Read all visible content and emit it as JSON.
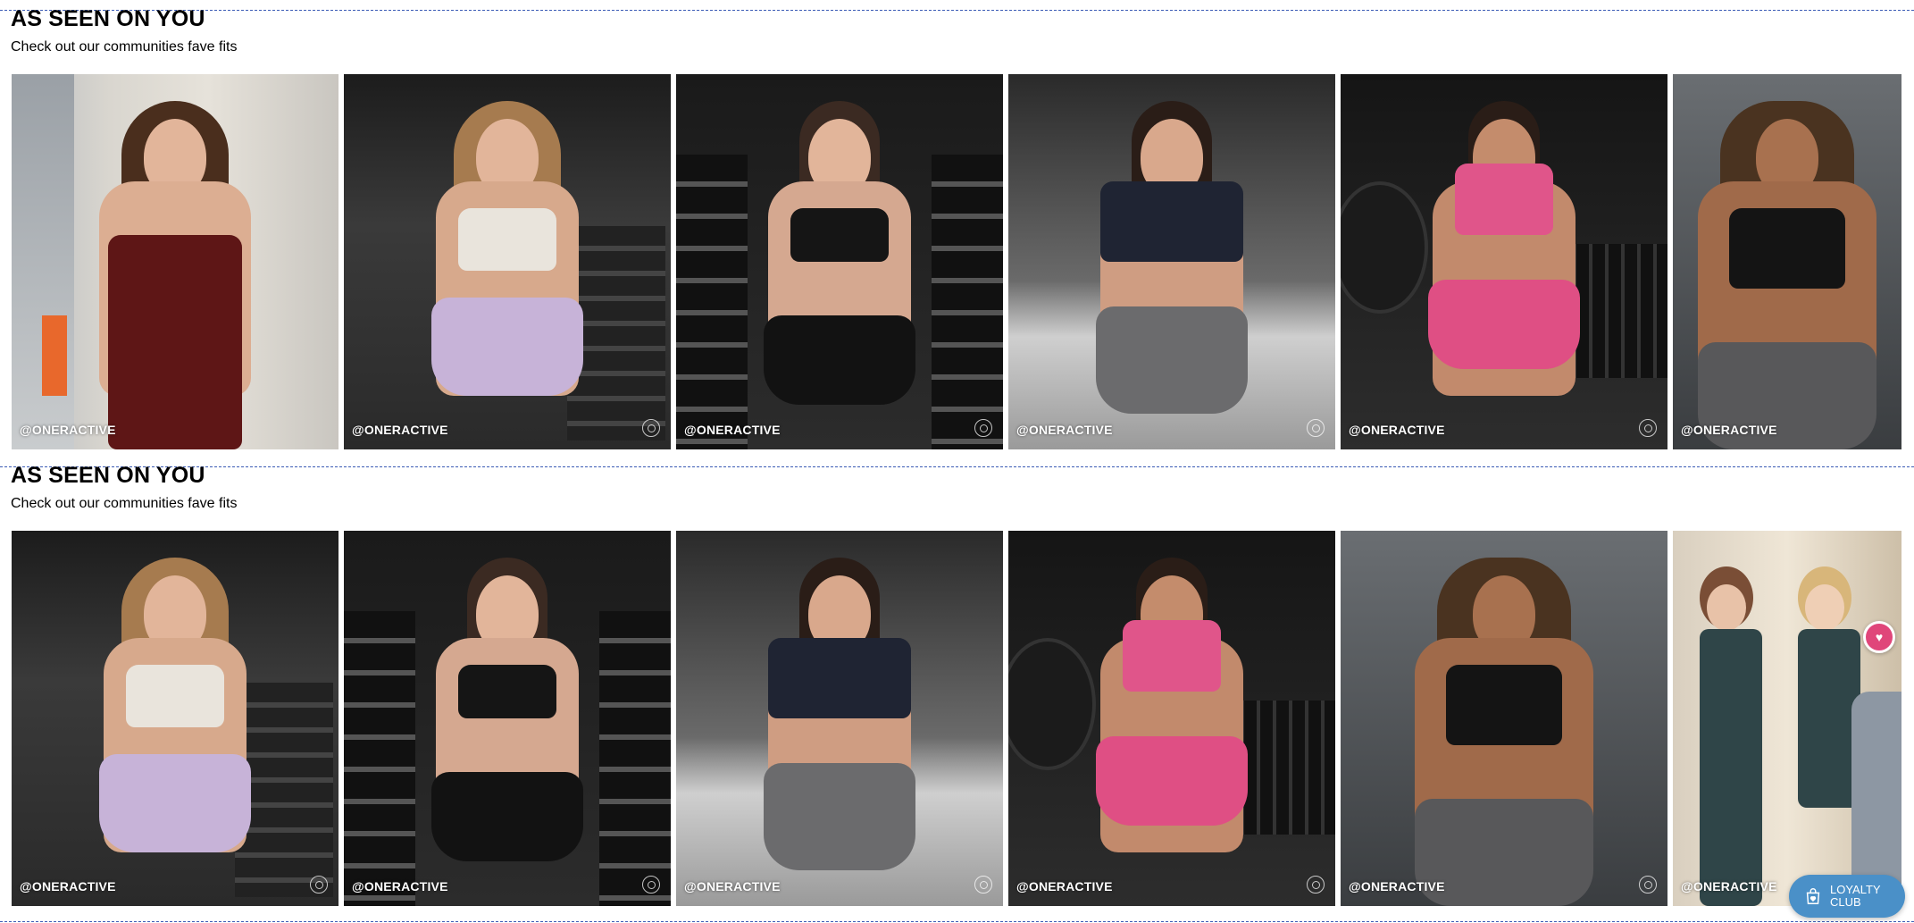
{
  "sections": [
    {
      "title": "AS SEEN ON YOU",
      "subtitle": "Check out our communities fave fits",
      "tiles": [
        {
          "handle": "@ONERACTIVE",
          "outfit": "burgundy jumpsuit",
          "icon": "instagram-icon"
        },
        {
          "handle": "@ONERACTIVE",
          "outfit": "lilac shorts, cream bra",
          "icon": "instagram-icon"
        },
        {
          "handle": "@ONERACTIVE",
          "outfit": "black shorts, black bra",
          "icon": "instagram-icon"
        },
        {
          "handle": "@ONERACTIVE",
          "outfit": "navy crop, grey shorts",
          "icon": "instagram-icon"
        },
        {
          "handle": "@ONERACTIVE",
          "outfit": "pink bra, pink shorts",
          "icon": "instagram-icon"
        },
        {
          "handle": "@ONERACTIVE",
          "outfit": "black bra, grey leggings",
          "icon": "instagram-icon"
        }
      ]
    },
    {
      "title": "AS SEEN ON YOU",
      "subtitle": "Check out our communities fave fits",
      "tiles": [
        {
          "handle": "@ONERACTIVE",
          "outfit": "lilac shorts, cream bra",
          "icon": "instagram-icon"
        },
        {
          "handle": "@ONERACTIVE",
          "outfit": "black shorts, black bra",
          "icon": "instagram-icon"
        },
        {
          "handle": "@ONERACTIVE",
          "outfit": "navy crop, grey shorts",
          "icon": "instagram-icon"
        },
        {
          "handle": "@ONERACTIVE",
          "outfit": "pink bra, pink shorts",
          "icon": "instagram-icon"
        },
        {
          "handle": "@ONERACTIVE",
          "outfit": "black bra, grey leggings",
          "icon": "instagram-icon"
        },
        {
          "handle": "@ONERACTIVE",
          "outfit": "teal jumpsuit pair",
          "icon": "instagram-icon"
        }
      ]
    }
  ],
  "loyalty_button": {
    "line1": "LOYALTY",
    "line2": "CLUB",
    "icon": "shopping-bag-heart-icon",
    "color": "#4a90c8"
  },
  "wishlist_button": {
    "icon": "heart-icon",
    "color": "#e0467a"
  },
  "colors": {
    "divider": "#3b5bb5",
    "handle_text": "#ffffff"
  }
}
